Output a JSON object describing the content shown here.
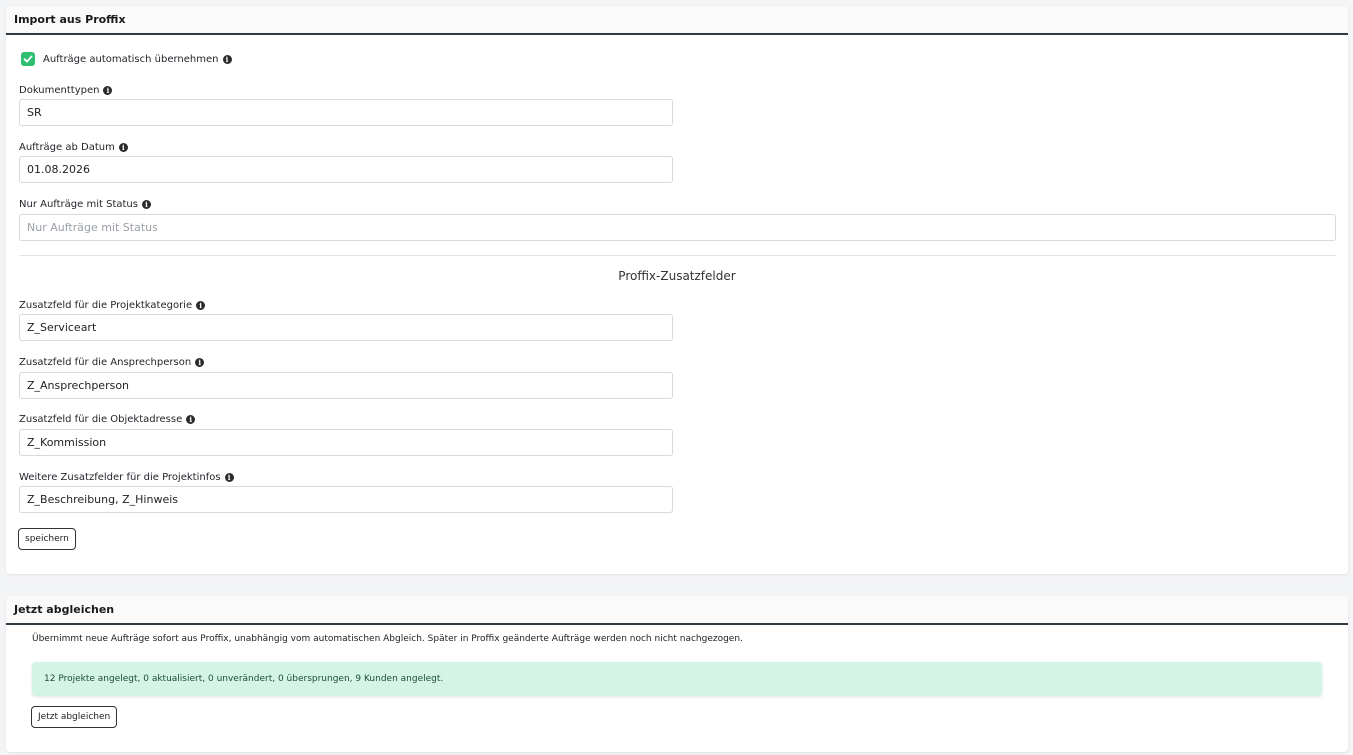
{
  "import_card": {
    "title": "Import aus Proffix",
    "auto_import": {
      "label": "Aufträge automatisch übernehmen",
      "checked": true
    },
    "fields": {
      "document_types": {
        "label": "Dokumenttypen",
        "value": "SR"
      },
      "orders_from_date": {
        "label": "Aufträge ab Datum",
        "value": "01.08.2026"
      },
      "status_filter": {
        "label": "Nur Aufträge mit Status",
        "placeholder": "Nur Aufträge mit Status",
        "value": ""
      }
    },
    "extra_fields_title": "Proffix-Zusatzfelder",
    "extra_fields": {
      "project_category": {
        "label": "Zusatzfeld für die Projektkategorie",
        "value": "Z_Serviceart"
      },
      "contact_person": {
        "label": "Zusatzfeld für die Ansprechperson",
        "value": "Z_Ansprechperson"
      },
      "object_address": {
        "label": "Zusatzfeld für die Objektadresse",
        "value": "Z_Kommission"
      },
      "project_infos": {
        "label": "Weitere Zusatzfelder für die Projektinfos",
        "value": "Z_Beschreibung, Z_Hinweis"
      }
    },
    "save_label": "speichern"
  },
  "sync_card": {
    "title": "Jetzt abgleichen",
    "description": "Übernimmt neue Aufträge sofort aus Proffix, unabhängig vom automatischen Abgleich. Später in Proffix geänderte Aufträge werden noch nicht nachgezogen.",
    "result_message": "12 Projekte angelegt, 0 aktualisiert, 0 unverändert, 0 übersprungen, 9 Kunden angelegt.",
    "sync_label": "Jetzt abgleichen"
  },
  "icons": {
    "info": "info-circle-icon",
    "check": "check-icon"
  },
  "colors": {
    "checkbox": "#2fbf71",
    "success_bg": "#d4f5e6",
    "header_border": "#2e3a44"
  }
}
